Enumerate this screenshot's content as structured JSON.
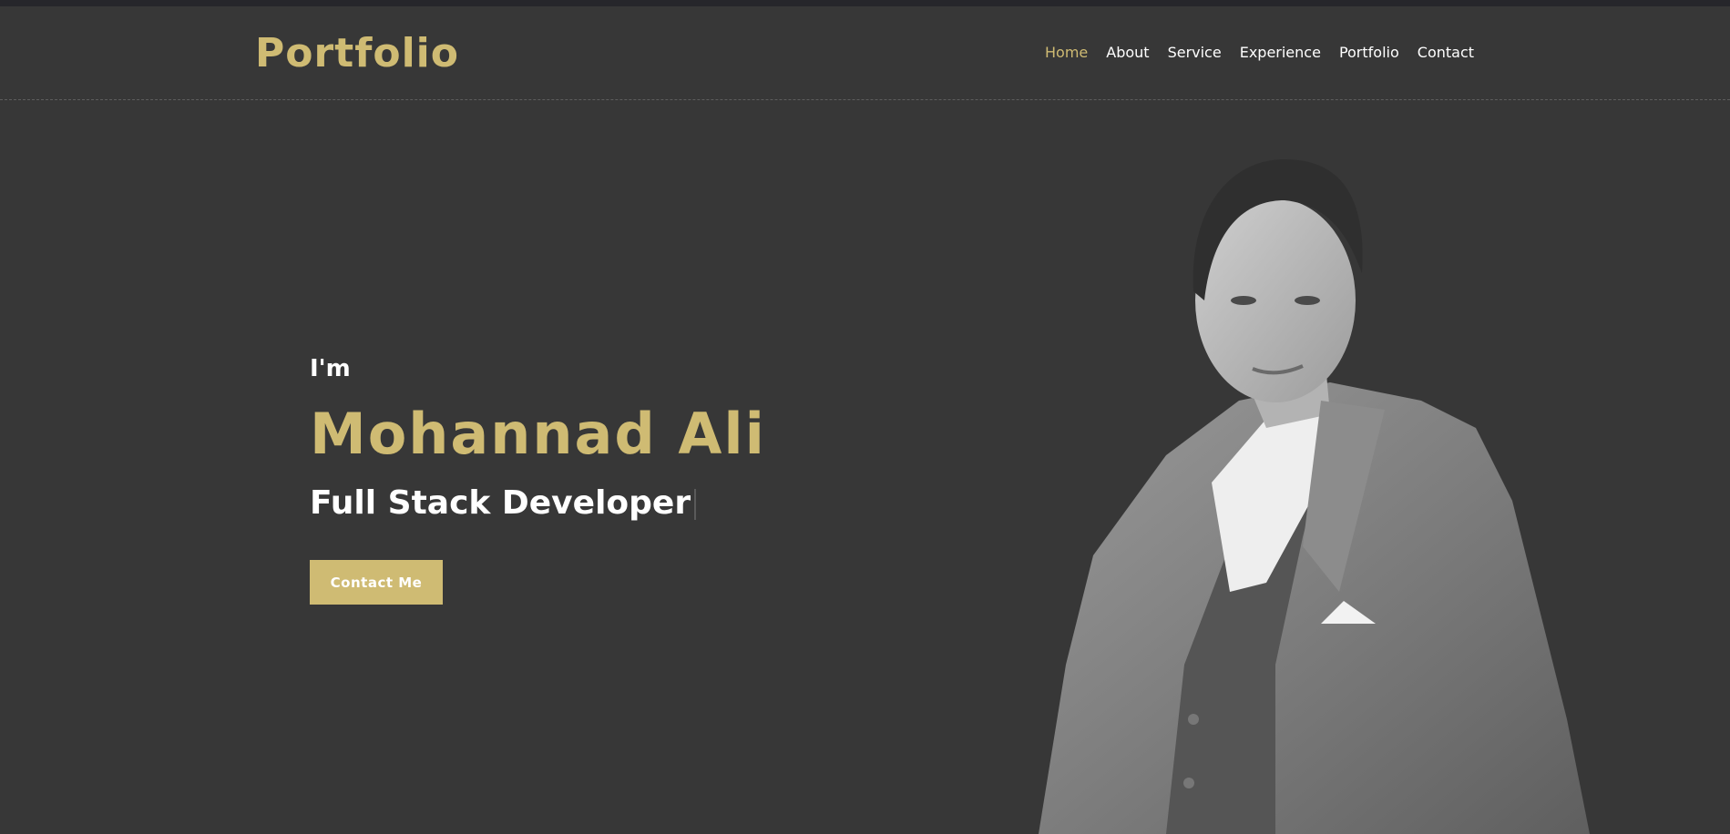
{
  "header": {
    "logo": "Portfolio",
    "nav": [
      {
        "label": "Home",
        "active": true
      },
      {
        "label": "About",
        "active": false
      },
      {
        "label": "Service",
        "active": false
      },
      {
        "label": "Experience",
        "active": false
      },
      {
        "label": "Portfolio",
        "active": false
      },
      {
        "label": "Contact",
        "active": false
      }
    ]
  },
  "hero": {
    "intro": "I'm",
    "name": "Mohannad Ali",
    "role": "Full Stack Developer",
    "cta_label": "Contact Me"
  },
  "colors": {
    "background": "#373737",
    "accent": "#cfbb73",
    "text": "#ffffff",
    "top_strip": "#26262b"
  }
}
